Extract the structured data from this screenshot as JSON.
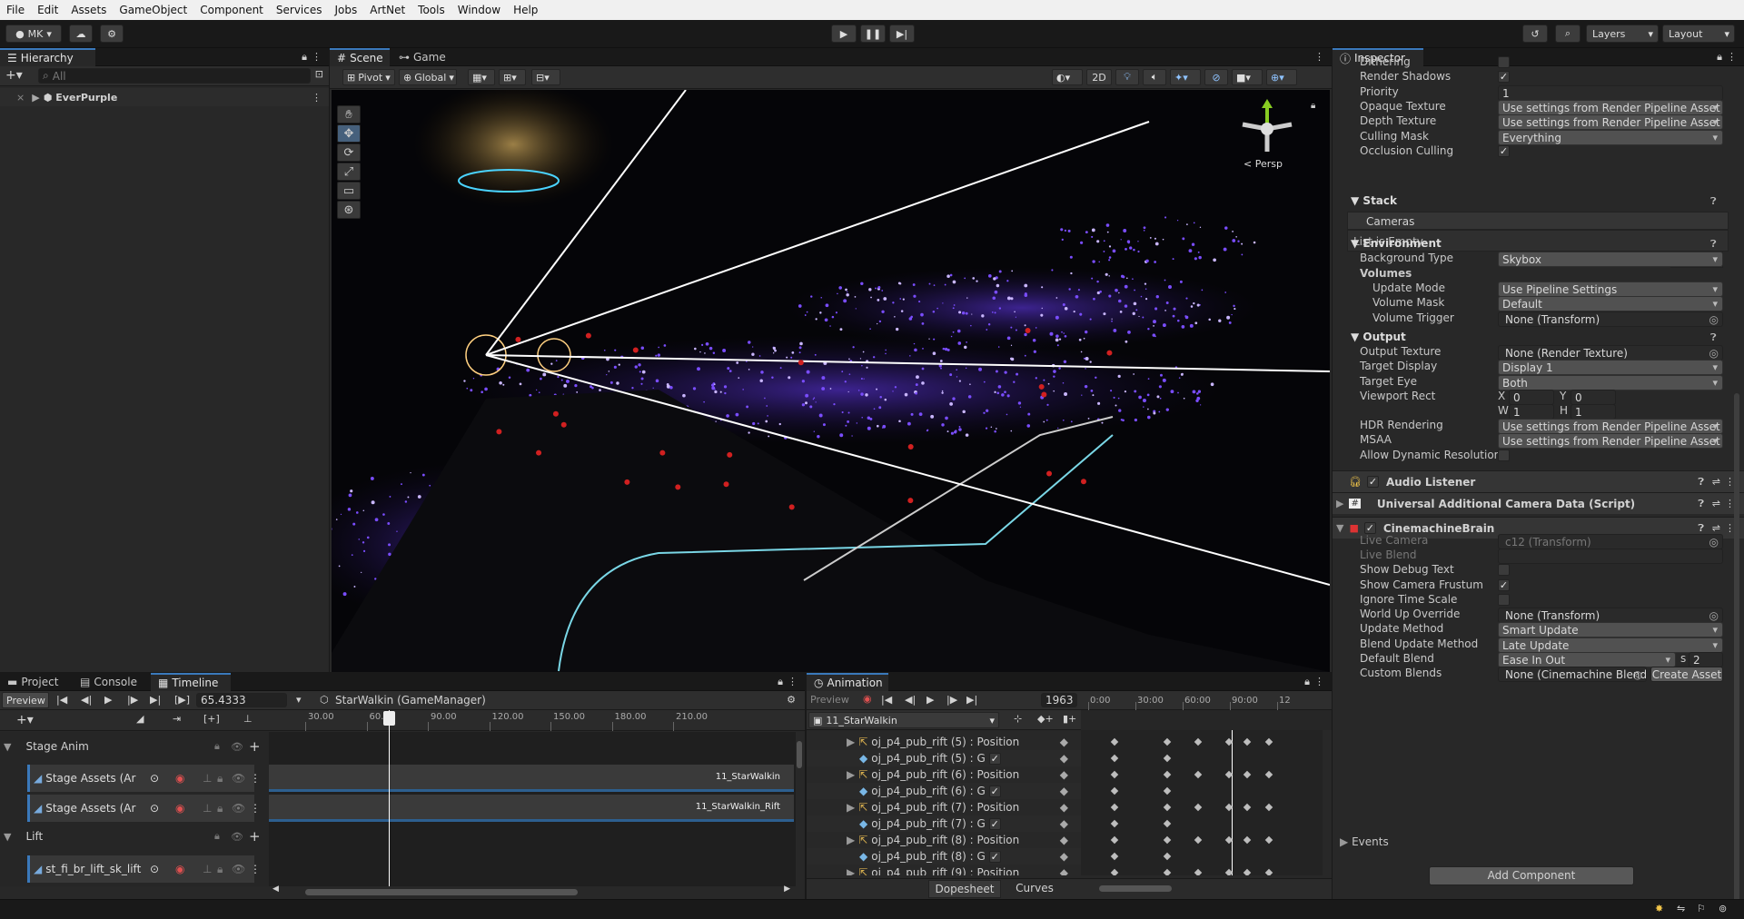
{
  "menu": [
    "File",
    "Edit",
    "Assets",
    "GameObject",
    "Component",
    "Services",
    "Jobs",
    "ArtNet",
    "Tools",
    "Window",
    "Help"
  ],
  "toolbar": {
    "account": "MK",
    "layers": "Layers",
    "layout": "Layout"
  },
  "hierarchy": {
    "tab": "Hierarchy",
    "search_placeholder": "All",
    "scene": "EverPurple"
  },
  "scene": {
    "tab_scene": "Scene",
    "tab_game": "Game",
    "pivot": "Pivot",
    "global": "Global",
    "mode2d": "2D",
    "persp": "< Persp"
  },
  "inspector": {
    "tab": "Inspector",
    "rows": [
      {
        "label": "Dithering",
        "type": "check",
        "value": ""
      },
      {
        "label": "Render Shadows",
        "type": "check",
        "value": "✓"
      },
      {
        "label": "Priority",
        "type": "text",
        "value": "1"
      },
      {
        "label": "Opaque Texture",
        "type": "drop",
        "value": "Use settings from Render Pipeline Asset"
      },
      {
        "label": "Depth Texture",
        "type": "drop",
        "value": "Use settings from Render Pipeline Asset"
      },
      {
        "label": "Culling Mask",
        "type": "drop",
        "value": "Everything"
      },
      {
        "label": "Occlusion Culling",
        "type": "check",
        "value": "✓"
      }
    ],
    "stack": {
      "title": "Stack",
      "cameras": "Cameras",
      "empty": "List is Empty"
    },
    "environment": {
      "title": "Environment",
      "background_type_label": "Background Type",
      "background_type": "Skybox",
      "volumes": "Volumes",
      "update_mode_label": "Update Mode",
      "update_mode": "Use Pipeline Settings",
      "volume_mask_label": "Volume Mask",
      "volume_mask": "Default",
      "volume_trigger_label": "Volume Trigger",
      "volume_trigger": "None (Transform)"
    },
    "output": {
      "title": "Output",
      "output_texture_label": "Output Texture",
      "output_texture": "None (Render Texture)",
      "target_display_label": "Target Display",
      "target_display": "Display 1",
      "target_eye_label": "Target Eye",
      "target_eye": "Both",
      "viewport_label": "Viewport Rect",
      "x": "0",
      "y": "0",
      "w": "1",
      "h": "1",
      "hdr_label": "HDR Rendering",
      "hdr": "Use settings from Render Pipeline Asset",
      "msaa_label": "MSAA",
      "msaa": "Use settings from Render Pipeline Asset",
      "dyn_label": "Allow Dynamic Resolutior"
    },
    "components": {
      "audio": "Audio Listener",
      "uacd": "Universal Additional Camera Data (Script)",
      "brain": "CinemachineBrain"
    },
    "brain_rows": [
      {
        "label": "Live Camera",
        "type": "obj",
        "value": "c12 (Transform)",
        "dim": true
      },
      {
        "label": "Live Blend",
        "type": "text",
        "value": "",
        "dim": true
      },
      {
        "label": "Show Debug Text",
        "type": "check",
        "value": ""
      },
      {
        "label": "Show Camera Frustum",
        "type": "check",
        "value": "✓"
      },
      {
        "label": "Ignore Time Scale",
        "type": "check",
        "value": ""
      },
      {
        "label": "World Up Override",
        "type": "obj",
        "value": "None (Transform)"
      },
      {
        "label": "Update Method",
        "type": "drop",
        "value": "Smart Update"
      },
      {
        "label": "Blend Update Method",
        "type": "drop",
        "value": "Late Update"
      },
      {
        "label": "Default Blend",
        "type": "drop",
        "value": "Ease In Out"
      },
      {
        "label": "Custom Blends",
        "type": "obj",
        "value": "None (Cinemachine Blend"
      }
    ],
    "default_blend_s": "s",
    "default_blend_val": "2",
    "create_asset": "Create Asset",
    "events": "Events",
    "add_component": "Add Component"
  },
  "timeline": {
    "tabs": [
      "Project",
      "Console",
      "Timeline"
    ],
    "preview": "Preview",
    "time": "65.4333",
    "director": "StarWalkin (GameManager)",
    "ruler": [
      "30.00",
      "60.00",
      "90.00",
      "120.00",
      "150.00",
      "180.00",
      "210.00"
    ],
    "groups": [
      {
        "name": "Stage Anim"
      },
      {
        "name": "Lift"
      }
    ],
    "tracks": [
      "Stage Assets (Ar",
      "Stage Assets (Ar",
      "st_fi_br_lift_sk_lift"
    ],
    "clips": [
      "11_StarWalkin",
      "11_StarWalkin_Rift"
    ]
  },
  "animation": {
    "tab": "Animation",
    "preview": "Preview",
    "frame": "1963",
    "clip": "11_StarWalkin",
    "ruler": [
      "0:00",
      "30:00",
      "60:00",
      "90:00",
      "12"
    ],
    "props": [
      "oj_p4_pub_rift (5) : Position",
      "oj_p4_pub_rift (5) : G",
      "oj_p4_pub_rift (6) : Position",
      "oj_p4_pub_rift (6) : G",
      "oj_p4_pub_rift (7) : Position",
      "oj_p4_pub_rift (7) : G",
      "oj_p4_pub_rift (8) : Position",
      "oj_p4_pub_rift (8) : G",
      "oj_p4_pub_rift (9) : Position"
    ],
    "dopesheet": "Dopesheet",
    "curves": "Curves"
  },
  "colors": {
    "accent": "#3a79bb",
    "purple": "#7a4dff",
    "red": "#d22"
  }
}
